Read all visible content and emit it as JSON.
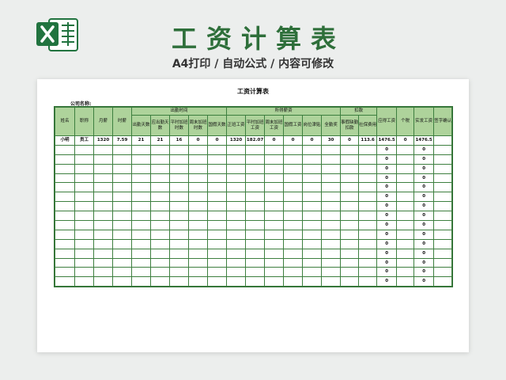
{
  "banner": {
    "title": "工资计算表",
    "subtitle": "A4打印 / 自动公式 / 内容可修改",
    "logo_icon": "excel-icon",
    "accent": "#2e6f3a"
  },
  "sheet": {
    "title": "工资计算表",
    "company_label": "公司名称:",
    "header_fill": "#aed39b",
    "border_color": "#3d7f3f"
  },
  "table": {
    "single_columns": {
      "name": "姓名",
      "position": "职称",
      "monthly_salary": "月薪",
      "hourly_wage": "时薪",
      "payable_salary": "应得工资",
      "personal_tax": "个税",
      "actual_salary": "实发工资",
      "signature": "签字确认"
    },
    "groups": {
      "attendance": "出勤时间",
      "earned": "所得薪资",
      "deductions": "扣款"
    },
    "sub_columns": {
      "attendance": [
        "出勤天数",
        "应出勤天数",
        "平时加班时数",
        "周末加班时数",
        "国假天数"
      ],
      "earned": [
        "正班工资",
        "平时加班工资",
        "周末加班工资",
        "国假工资",
        "岗位津贴",
        "全勤奖"
      ],
      "deductions": [
        "事假缺勤扣款",
        "社保费用"
      ]
    },
    "rows": [
      [
        "小明",
        "员工",
        "1320",
        "7.59",
        "21",
        "21",
        "16",
        "0",
        "0",
        "1320",
        "182.07",
        "0",
        "0",
        "0",
        "30",
        "0",
        "113.6",
        "1476.5",
        "0",
        "1476.5",
        ""
      ],
      [
        "",
        "",
        "",
        "",
        "",
        "",
        "",
        "",
        "",
        "",
        "",
        "",
        "",
        "",
        "",
        "",
        "",
        "0",
        "",
        "0",
        ""
      ],
      [
        "",
        "",
        "",
        "",
        "",
        "",
        "",
        "",
        "",
        "",
        "",
        "",
        "",
        "",
        "",
        "",
        "",
        "0",
        "",
        "0",
        ""
      ],
      [
        "",
        "",
        "",
        "",
        "",
        "",
        "",
        "",
        "",
        "",
        "",
        "",
        "",
        "",
        "",
        "",
        "",
        "0",
        "",
        "0",
        ""
      ],
      [
        "",
        "",
        "",
        "",
        "",
        "",
        "",
        "",
        "",
        "",
        "",
        "",
        "",
        "",
        "",
        "",
        "",
        "0",
        "",
        "0",
        ""
      ],
      [
        "",
        "",
        "",
        "",
        "",
        "",
        "",
        "",
        "",
        "",
        "",
        "",
        "",
        "",
        "",
        "",
        "",
        "0",
        "",
        "0",
        ""
      ],
      [
        "",
        "",
        "",
        "",
        "",
        "",
        "",
        "",
        "",
        "",
        "",
        "",
        "",
        "",
        "",
        "",
        "",
        "0",
        "",
        "0",
        ""
      ],
      [
        "",
        "",
        "",
        "",
        "",
        "",
        "",
        "",
        "",
        "",
        "",
        "",
        "",
        "",
        "",
        "",
        "",
        "0",
        "",
        "0",
        ""
      ],
      [
        "",
        "",
        "",
        "",
        "",
        "",
        "",
        "",
        "",
        "",
        "",
        "",
        "",
        "",
        "",
        "",
        "",
        "0",
        "",
        "0",
        ""
      ],
      [
        "",
        "",
        "",
        "",
        "",
        "",
        "",
        "",
        "",
        "",
        "",
        "",
        "",
        "",
        "",
        "",
        "",
        "0",
        "",
        "0",
        ""
      ],
      [
        "",
        "",
        "",
        "",
        "",
        "",
        "",
        "",
        "",
        "",
        "",
        "",
        "",
        "",
        "",
        "",
        "",
        "0",
        "",
        "0",
        ""
      ],
      [
        "",
        "",
        "",
        "",
        "",
        "",
        "",
        "",
        "",
        "",
        "",
        "",
        "",
        "",
        "",
        "",
        "",
        "0",
        "",
        "0",
        ""
      ],
      [
        "",
        "",
        "",
        "",
        "",
        "",
        "",
        "",
        "",
        "",
        "",
        "",
        "",
        "",
        "",
        "",
        "",
        "0",
        "",
        "0",
        ""
      ],
      [
        "",
        "",
        "",
        "",
        "",
        "",
        "",
        "",
        "",
        "",
        "",
        "",
        "",
        "",
        "",
        "",
        "",
        "0",
        "",
        "0",
        ""
      ],
      [
        "",
        "",
        "",
        "",
        "",
        "",
        "",
        "",
        "",
        "",
        "",
        "",
        "",
        "",
        "",
        "",
        "",
        "0",
        "",
        "0",
        ""
      ],
      [
        "",
        "",
        "",
        "",
        "",
        "",
        "",
        "",
        "",
        "",
        "",
        "",
        "",
        "",
        "",
        "",
        "",
        "0",
        "",
        "0",
        ""
      ]
    ]
  }
}
